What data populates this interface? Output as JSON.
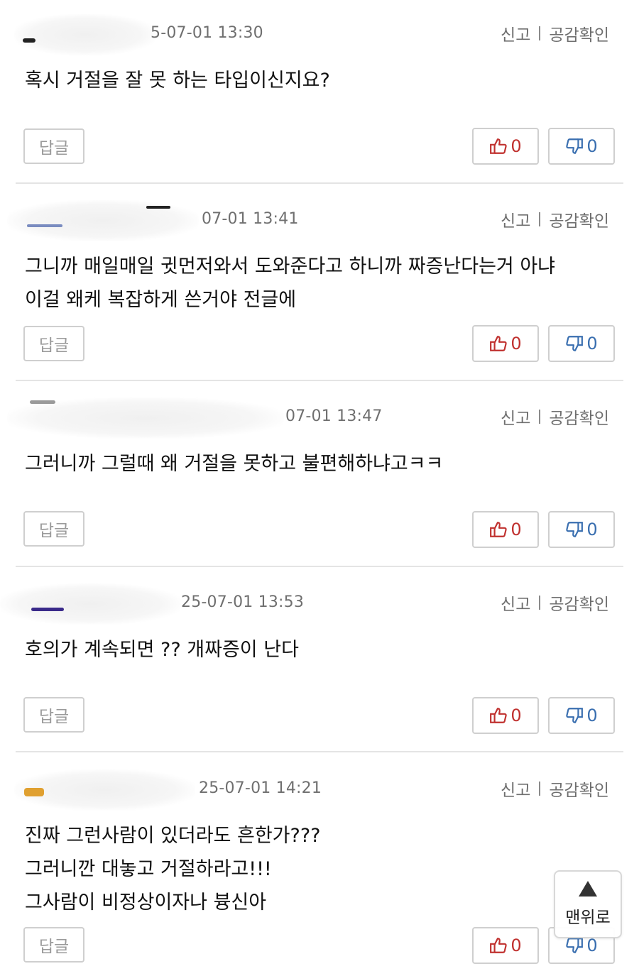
{
  "ui": {
    "report_label": "신고",
    "empathy_label": "공감확인",
    "reply_label": "답글",
    "scroll_top_label": "맨위로"
  },
  "comments": [
    {
      "date": "5-07-01 13:30",
      "lines": [
        "혹시 거절을 잘 못 하는 타입이신지요?"
      ],
      "up": "0",
      "down": "0"
    },
    {
      "date": "07-01 13:41",
      "lines": [
        "그니까 매일매일 귓먼저와서 도와준다고 하니까 짜증난다는거 아냐",
        "이걸 왜케 복잡하게 쓴거야 전글에"
      ],
      "up": "0",
      "down": "0"
    },
    {
      "date": "07-01 13:47",
      "lines": [
        "그러니까 그럴때 왜 거절을 못하고 불편해하냐고ㅋㅋ"
      ],
      "up": "0",
      "down": "0"
    },
    {
      "date": "25-07-01 13:53",
      "lines": [
        "호의가 계속되면 ?? 개짜증이 난다"
      ],
      "up": "0",
      "down": "0"
    },
    {
      "date": "25-07-01 14:21",
      "lines": [
        "진짜 그런사람이 있더라도 흔한가???",
        "그러니깐 대놓고 거절하라고!!!",
        "그사람이 비정상이자나 븅신아"
      ],
      "up": "0",
      "down": "0"
    }
  ]
}
